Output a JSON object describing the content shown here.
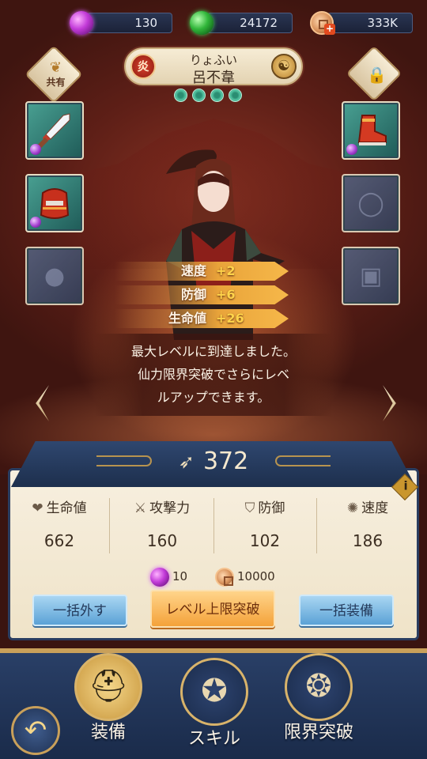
{
  "currencies": [
    {
      "icon": "purple-gem-icon",
      "value": "130"
    },
    {
      "icon": "green-gem-icon",
      "value": "24172"
    },
    {
      "icon": "coin-icon",
      "value": "333K"
    }
  ],
  "hero": {
    "element": "炎",
    "name_kana": "りょふい",
    "name": "呂不韋",
    "stars": 4
  },
  "shared_badge": {
    "label": "共有"
  },
  "stat_gains": [
    {
      "label": "速度",
      "value": "+2"
    },
    {
      "label": "防御",
      "value": "+6"
    },
    {
      "label": "生命値",
      "value": "+26"
    }
  ],
  "max_message": {
    "line1": "最大レベルに到達しました。",
    "line2": "仙力限界突破でさらにレベ",
    "line3": "ルアップできます。"
  },
  "power": {
    "value": "372"
  },
  "stats": [
    {
      "label": "生命値",
      "icon": "heart-icon",
      "value": "662"
    },
    {
      "label": "攻撃力",
      "icon": "crossed-swords-icon",
      "value": "160"
    },
    {
      "label": "防御",
      "icon": "shield-icon",
      "value": "102"
    },
    {
      "label": "速度",
      "icon": "swirl-icon",
      "value": "186"
    }
  ],
  "cost": {
    "gem": "10",
    "coin": "10000"
  },
  "buttons": {
    "unequip_all": "一括外す",
    "limit_break": "レベル上限突破",
    "equip_all": "一括装備"
  },
  "nav": {
    "equip": "装備",
    "skill": "スキル",
    "limit_break": "限界突破"
  },
  "colors": {
    "accent_gold": "#d8b36a",
    "panel_navy": "#2a3d60",
    "gain_orange": "#f6b84a"
  }
}
